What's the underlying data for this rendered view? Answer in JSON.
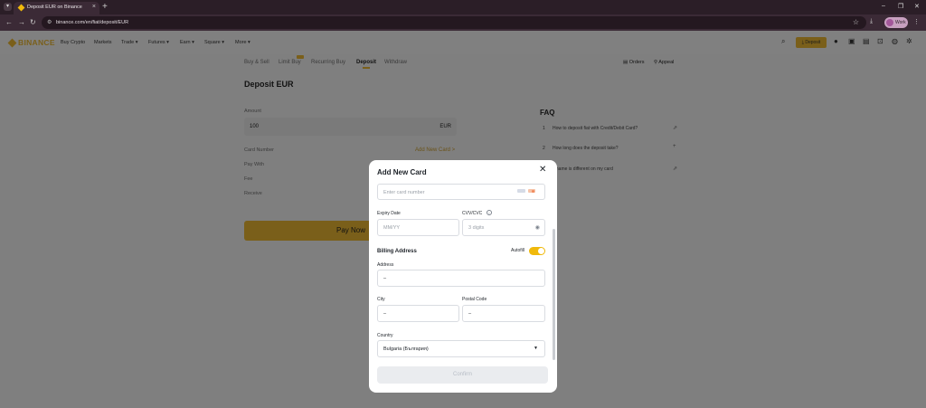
{
  "browser": {
    "tab_title": "Deposit EUR on Binance",
    "url": "binance.com/en/fiat/deposit/EUR",
    "profile_label": "Work"
  },
  "header": {
    "logo": "BINANCE",
    "nav": [
      "Buy Crypto",
      "Markets",
      "Trade",
      "Futures",
      "Earn",
      "Square",
      "More"
    ],
    "deposit_label": "Deposit"
  },
  "subnav": {
    "tabs": [
      "Buy & Sell",
      "Limit Buy",
      "Recurring Buy",
      "Deposit",
      "Withdraw"
    ],
    "active": "Deposit",
    "orders": "Orders",
    "appeal": "Appeal"
  },
  "page": {
    "title": "Deposit EUR",
    "amount_label": "Amount",
    "amount_value": "100",
    "currency": "EUR",
    "card_number_label": "Card Number",
    "add_card_link": "Add New Card >",
    "pay_with_label": "Pay With",
    "fee_label": "Fee",
    "receive_label": "Receive",
    "pay_now": "Pay Now"
  },
  "faq": {
    "title": "FAQ",
    "items": [
      {
        "num": "1",
        "text": "How to deposit fiat with Credit/Debit Card?"
      },
      {
        "num": "2",
        "text": "How long does the deposit take?"
      },
      {
        "num": "",
        "text": "y name is different on my card"
      }
    ]
  },
  "modal": {
    "title": "Add New Card",
    "card_number_placeholder": "Enter card number",
    "expiry_label": "Expiry Date",
    "expiry_placeholder": "MM/YY",
    "cvv_label": "CVV/CVC",
    "cvv_placeholder": "3 digits",
    "billing_label": "Billing Address",
    "autofill_label": "Autofill",
    "autofill_on": true,
    "address_label": "Address",
    "address_value": "–",
    "city_label": "City",
    "city_value": "–",
    "postal_label": "Postal Code",
    "postal_value": "–",
    "country_label": "Country",
    "country_value": "Bulgaria (България)",
    "confirm": "Confirm"
  },
  "colors": {
    "accent": "#f0b90b",
    "overlay": "#7f7f7f"
  }
}
